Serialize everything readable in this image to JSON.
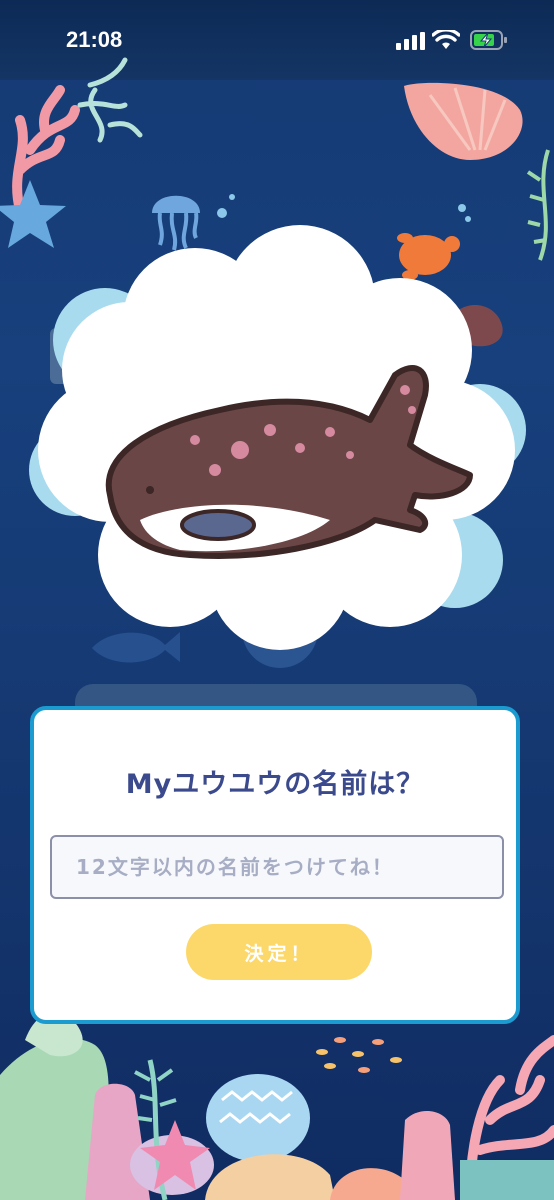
{
  "status_bar": {
    "time": "21:08"
  },
  "dialog": {
    "title": "Myユウユウの名前は？",
    "name_input": {
      "placeholder": "12文字以内の名前をつけてね！",
      "value": ""
    },
    "decide_button": "決定！"
  },
  "colors": {
    "background": "#163a74",
    "dialog_border": "#1b9bd0",
    "title_text": "#3b4a8c",
    "button_fill": "#fcd86a"
  },
  "character": {
    "icon": "whale-shark-mascot"
  }
}
